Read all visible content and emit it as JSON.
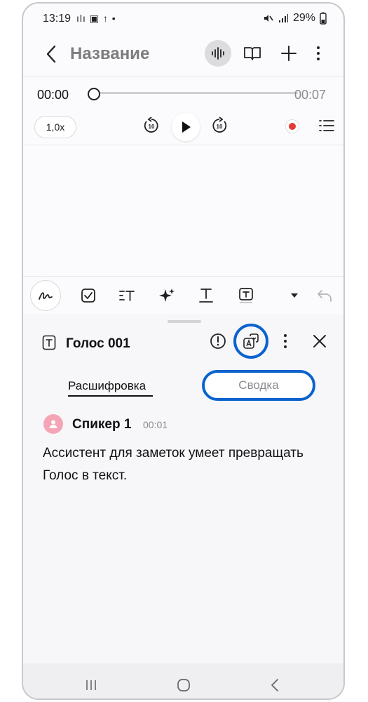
{
  "status_bar": {
    "time": "13:19",
    "left_icons": "ılı ▣ ↑ •",
    "battery": "29%"
  },
  "header": {
    "title": "Название"
  },
  "player": {
    "current_time": "00:00",
    "total_time": "00:07",
    "speed": "1,0x",
    "rewind_label": "10",
    "forward_label": "10",
    "progress": 0
  },
  "transcript": {
    "title": "Голос 001",
    "tabs": [
      "Расшифровка",
      "Сводка"
    ],
    "speaker": "Спикер 1",
    "speaker_time": "00:01",
    "text": "Ассистент для заметок умеет превращать Голос в текст."
  },
  "colors": {
    "accent_ring": "#0b63ce",
    "record": "#e53935",
    "avatar": "#f4a5b5"
  }
}
